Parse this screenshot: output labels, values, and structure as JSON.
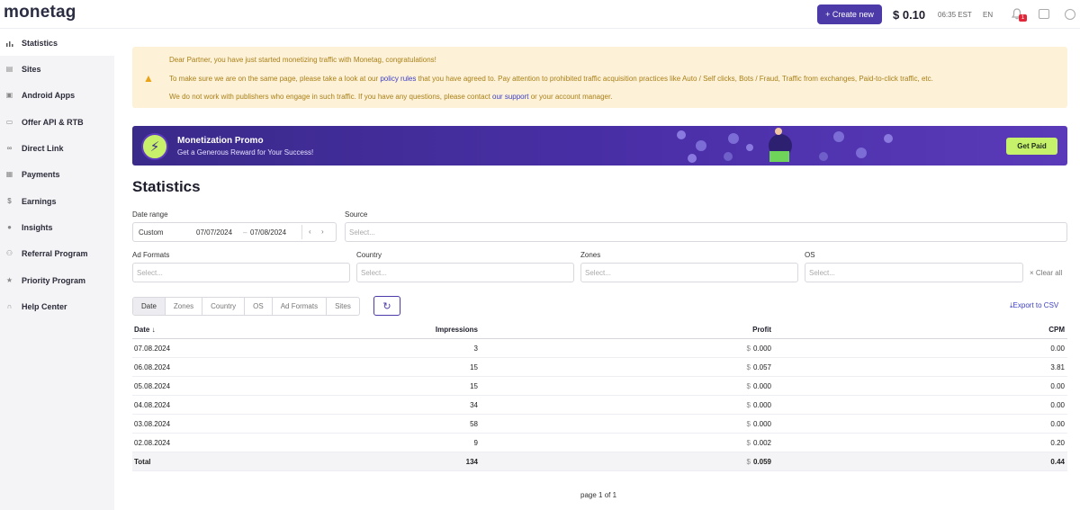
{
  "topbar": {
    "logo": "monetag",
    "create_label": "+ Create new",
    "balance": "$ 0.10",
    "time": "06:35 EST",
    "lang": "EN",
    "notif_count": "1"
  },
  "sidebar": {
    "items": [
      {
        "label": "Statistics",
        "icon": "bar-chart-icon"
      },
      {
        "label": "Sites",
        "icon": "sites-icon"
      },
      {
        "label": "Android Apps",
        "icon": "android-icon"
      },
      {
        "label": "Offer API & RTB",
        "icon": "document-icon"
      },
      {
        "label": "Direct Link",
        "icon": "link-icon"
      },
      {
        "label": "Payments",
        "icon": "payments-icon"
      },
      {
        "label": "Earnings",
        "icon": "dollar-icon"
      },
      {
        "label": "Insights",
        "icon": "insights-icon"
      },
      {
        "label": "Referral Program",
        "icon": "people-icon"
      },
      {
        "label": "Priority Program",
        "icon": "star-icon"
      },
      {
        "label": "Help Center",
        "icon": "headset-icon"
      }
    ]
  },
  "notice": {
    "line1": "Dear Partner, you have just started monetizing traffic with Monetag, congratulations!",
    "line2_a": "To make sure we are on the same page, please take a look at our ",
    "line2_link": "policy rules",
    "line2_b": " that you have agreed to. Pay attention to prohibited traffic acquisition practices like Auto / Self clicks, Bots / Fraud, Traffic from exchanges, Paid-to-click traffic, etc.",
    "line3_a": "We do not work with publishers who engage in such traffic. If you have any questions, please contact ",
    "line3_link": "our support",
    "line3_b": " or your account manager."
  },
  "promo": {
    "title": "Monetization Promo",
    "subtitle": "Get a Generous Reward for Your Success!",
    "button": "Get Paid"
  },
  "stats": {
    "title": "Statistics",
    "date_range_label": "Date range",
    "date_range_value": "Custom",
    "date_from": "07/07/2024",
    "date_to": "07/08/2024",
    "source_label": "Source",
    "ad_formats_label": "Ad Formats",
    "country_label": "Country",
    "zones_label": "Zones",
    "os_label": "OS",
    "select_placeholder": "Select...",
    "clear_all": "× Clear all",
    "export": "Export to CSV",
    "tabs": [
      "Date",
      "Zones",
      "Country",
      "OS",
      "Ad Formats",
      "Sites"
    ],
    "columns": {
      "date": "Date",
      "impressions": "Impressions",
      "profit": "Profit",
      "cpm": "CPM"
    },
    "rows": [
      {
        "date": "07.08.2024",
        "impressions": "3",
        "profit": "0.000",
        "cpm": "0.00"
      },
      {
        "date": "06.08.2024",
        "impressions": "15",
        "profit": "0.057",
        "cpm": "3.81"
      },
      {
        "date": "05.08.2024",
        "impressions": "15",
        "profit": "0.000",
        "cpm": "0.00"
      },
      {
        "date": "04.08.2024",
        "impressions": "34",
        "profit": "0.000",
        "cpm": "0.00"
      },
      {
        "date": "03.08.2024",
        "impressions": "58",
        "profit": "0.000",
        "cpm": "0.00"
      },
      {
        "date": "02.08.2024",
        "impressions": "9",
        "profit": "0.002",
        "cpm": "0.20"
      }
    ],
    "total": {
      "label": "Total",
      "impressions": "134",
      "profit": "0.059",
      "cpm": "0.44"
    },
    "pager": "page 1 of 1"
  },
  "colors": {
    "accent": "#4b3aa8",
    "promo_button": "#c6f16b",
    "notice_bg": "#fdf1d8"
  }
}
